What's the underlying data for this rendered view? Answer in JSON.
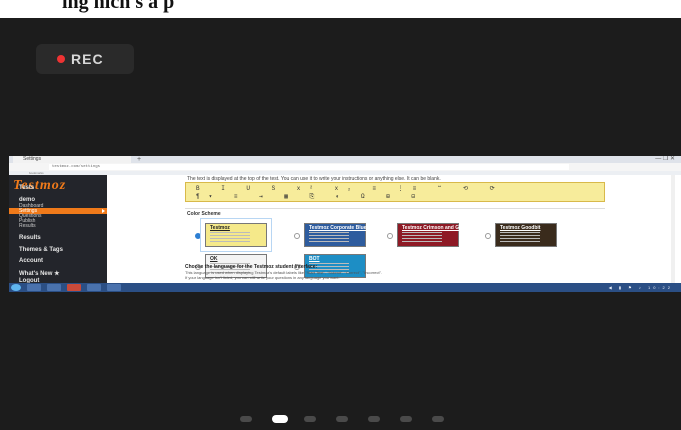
{
  "caption": "ing hich s a p",
  "recorder": {
    "label": "REC"
  },
  "browser": {
    "tab_title": "Settings",
    "new_tab": "+",
    "window_controls": "—  ❐  ✕",
    "url": "testmoz.com/settings",
    "bookmarks": "bookmarks"
  },
  "sidebar": {
    "logo": "Testmoz",
    "items": [
      {
        "label": "Tests",
        "bold": true
      },
      {
        "label": "demo",
        "bold": true
      },
      {
        "label": "Dashboard"
      },
      {
        "label": "Settings",
        "active": true
      },
      {
        "label": "Questions"
      },
      {
        "label": "Publish"
      },
      {
        "label": "Results"
      },
      {
        "label": "Results",
        "bold": true
      },
      {
        "label": "Themes & Tags",
        "bold": true
      },
      {
        "label": "Account",
        "bold": true
      },
      {
        "label": "What's New ★",
        "bold": true
      },
      {
        "label": "Logout",
        "bold": true
      }
    ]
  },
  "main": {
    "notice": "The text is displayed at the top of the test. You can use it to write your instructions or anything else. It can be blank.",
    "toolbar_row1": "B  I  U  S  x²  x₂  ≡  ⋮≡  ❝  ⟲  ⟳",
    "toolbar_row2": "¶▾  ≡  ⇥  ▦  ⎘  ◐  Ω  ⊞  ⊟",
    "color_scheme_heading": "Color Scheme",
    "schemes": [
      {
        "name": "Testmoz",
        "bg": "#f5e98a",
        "title_color": "#222222",
        "selected": true
      },
      {
        "name": "Testmoz Corporate Blues",
        "bg": "#2e5c9e",
        "title_color": "#ffffff"
      },
      {
        "name": "Testmoz Crimson and Gray",
        "bg": "#8e1a25",
        "title_color": "#ffffff"
      },
      {
        "name": "Testmoz Goodbit",
        "bg": "#3a2b1c",
        "title_color": "#ffffff"
      },
      {
        "name": "OK",
        "bg": "#f4f4f4",
        "title_color": "#222222"
      },
      {
        "name": "BOT",
        "bg": "#1d8ec5",
        "title_color": "#ffffff"
      }
    ],
    "language_heading": "Choose the language for the Testmoz student interface:",
    "language_line1": "This language is used when displaying Testmoz's default labels like \"Start Test\", \"Submit\", \"Correct\", \"Incorrect\".",
    "language_line2": "If your language isn't listed, you can still write your questions in any language you want."
  },
  "taskbar": {
    "tray": "◀ ▮ ⚑ ♪ 10:22"
  },
  "pager": {
    "count": 7,
    "active_index": 1
  }
}
